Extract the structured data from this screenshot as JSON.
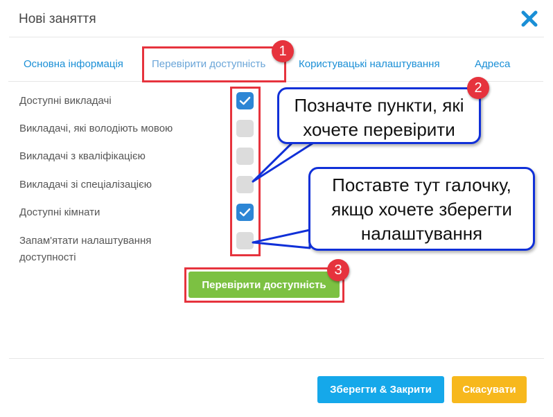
{
  "dialog": {
    "title": "Нові заняття"
  },
  "tabs": [
    {
      "label": "Основна інформація",
      "active": false
    },
    {
      "label": "Перевірити доступність",
      "active": true
    },
    {
      "label": "Користувацькі налаштування",
      "active": false
    },
    {
      "label": "Адреса",
      "active": false
    }
  ],
  "options": [
    {
      "label": "Доступні викладачі",
      "checked": true
    },
    {
      "label": "Викладачі, які володіють мовою",
      "checked": false
    },
    {
      "label": "Викладачі з кваліфікацією",
      "checked": false
    },
    {
      "label": "Викладачі зі спеціалізацією",
      "checked": false
    },
    {
      "label": "Доступні кімнати",
      "checked": true
    },
    {
      "label_line1": "Запам'ятати налаштування",
      "label_line2": "доступності",
      "checked": false
    }
  ],
  "buttons": {
    "check_availability": "Перевірити доступність",
    "save_close": "Зберегти & Закрити",
    "cancel": "Скасувати"
  },
  "annotations": {
    "badge1": "1",
    "badge2": "2",
    "badge3": "3",
    "callout1_line1": "Позначте пункти, які",
    "callout1_line2": "хочете перевірити",
    "callout2_line1": "Поставте тут галочку,",
    "callout2_line2": "якщо хочете зберегти",
    "callout2_line3": "налаштування"
  },
  "colors": {
    "accent": "#1a8fd6",
    "checked": "#2d86d5",
    "green_button": "#7cc142",
    "save_button": "#15a8ea",
    "cancel_button": "#f7b81d",
    "annotation_red": "#e6333d",
    "callout_blue": "#1030d8"
  }
}
